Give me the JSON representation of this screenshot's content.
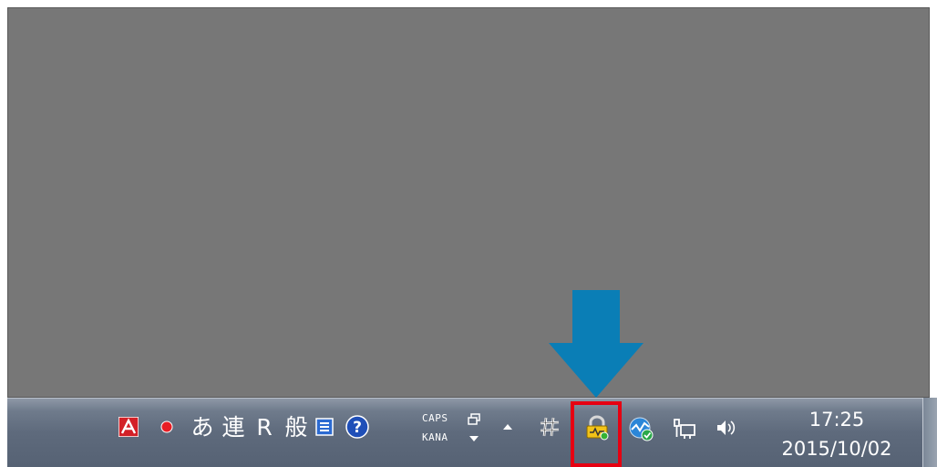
{
  "taskbar": {
    "ime_bar": {
      "hiragana_mode": "あ",
      "conversion_mode": "連",
      "r_label": "R",
      "dictionary_mode": "般",
      "caps_label": "CAPS",
      "kana_label": "KANA"
    },
    "tray_icons": [
      "adobe-reader-icon",
      "record-icon",
      "ime-pad-icon",
      "help-icon",
      "restore-icon",
      "dropdown-icon",
      "show-hidden-icons-icon",
      "hash-tool-icon",
      "vpn-lock-icon",
      "network-monitor-icon",
      "network-icon",
      "volume-icon"
    ],
    "clock": {
      "time": "17:25",
      "date": "2015/10/02"
    }
  },
  "colors": {
    "desktop": "#777777",
    "arrow": "#0a7eb6",
    "highlight": "#e60012",
    "taskbar": "#5e6a7c"
  }
}
